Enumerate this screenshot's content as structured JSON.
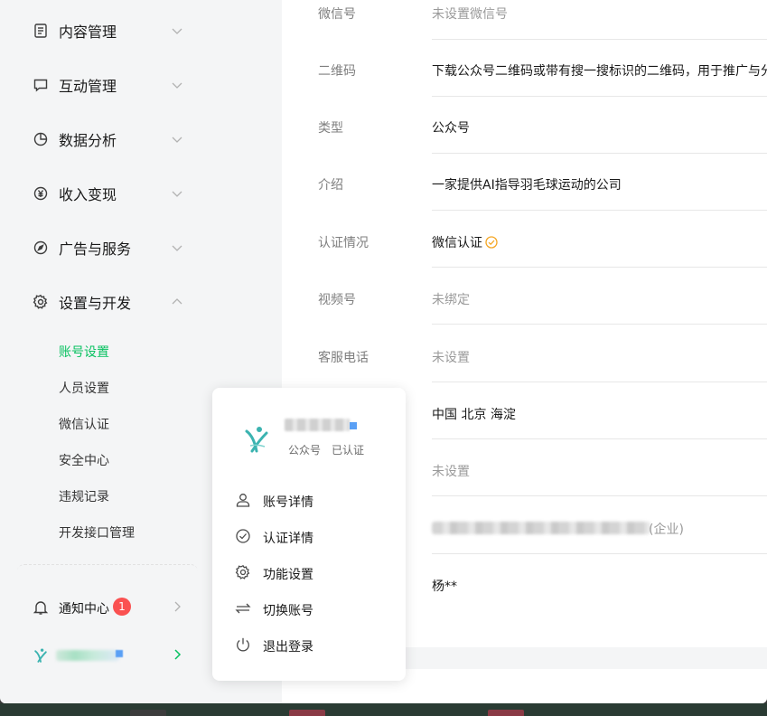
{
  "sidebar": {
    "nav": [
      {
        "label": "内容管理",
        "icon": "document-icon"
      },
      {
        "label": "互动管理",
        "icon": "message-icon"
      },
      {
        "label": "数据分析",
        "icon": "pie-chart-icon"
      },
      {
        "label": "收入变现",
        "icon": "yen-icon"
      },
      {
        "label": "广告与服务",
        "icon": "compass-icon"
      },
      {
        "label": "设置与开发",
        "icon": "gear-icon"
      }
    ],
    "sub_items": [
      {
        "label": "账号设置",
        "active": true
      },
      {
        "label": "人员设置"
      },
      {
        "label": "微信认证"
      },
      {
        "label": "安全中心"
      },
      {
        "label": "违规记录"
      },
      {
        "label": "开发接口管理"
      }
    ],
    "notify": {
      "label": "通知中心",
      "badge": "1"
    }
  },
  "main": {
    "rows": [
      {
        "key": "微信号",
        "value": "未设置微信号"
      },
      {
        "key": "二维码",
        "value": "下载公众号二维码或带有搜一搜标识的二维码，用于推广与分享"
      },
      {
        "key": "类型",
        "value": "公众号"
      },
      {
        "key": "介绍",
        "value": "一家提供AI指导羽毛球运动的公司"
      },
      {
        "key": "认证情况",
        "value": "微信认证"
      },
      {
        "key": "视频号",
        "value": "未绑定"
      },
      {
        "key": "客服电话",
        "value": "未设置"
      },
      {
        "key": "",
        "value": "中国 北京 海淀"
      },
      {
        "key": "",
        "value": "未设置"
      },
      {
        "key": "",
        "value": "(企业)"
      },
      {
        "key": "",
        "value": "杨**"
      }
    ]
  },
  "popup": {
    "type": "公众号",
    "status": "已认证",
    "menu": [
      {
        "label": "账号详情",
        "icon": "user-icon"
      },
      {
        "label": "认证详情",
        "icon": "check-circle-icon"
      },
      {
        "label": "功能设置",
        "icon": "gear-icon"
      },
      {
        "label": "切换账号",
        "icon": "switch-icon"
      },
      {
        "label": "退出登录",
        "icon": "power-icon"
      }
    ]
  },
  "colors": {
    "accent": "#07c160",
    "badge": "#fa5151",
    "verified": "#f5a623"
  }
}
